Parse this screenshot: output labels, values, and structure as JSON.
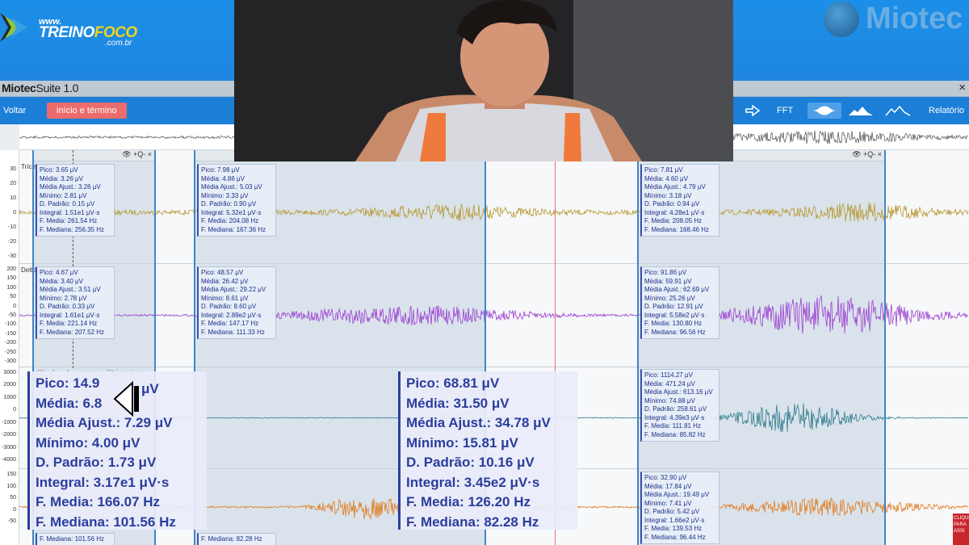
{
  "brand": {
    "www": "www.",
    "name_a": "TREINO",
    "name_b": "FOCO",
    "domain": ".com.br",
    "partner": "Miotec"
  },
  "app": {
    "title_a": "Miotec",
    "title_b": "Suite 1.0",
    "close": "×"
  },
  "toolbar": {
    "voltar": "Voltar",
    "inicio_termino": "início e término",
    "fft": "FFT",
    "relatorio": "Relatório"
  },
  "colors": {
    "ch1": "#b8972f",
    "ch2": "#9b3fd1",
    "ch3": "#2f7b8e",
    "ch4": "#e07a1e",
    "accent": "#1b7fd7",
    "stat_text": "#1d2f8a"
  },
  "axis_ticks": {
    "ch1": [
      "30",
      "20",
      "10",
      "0",
      "-10",
      "-20",
      "-30"
    ],
    "ch2": [
      "200",
      "150",
      "100",
      "50",
      "0",
      "-50",
      "-100",
      "-150",
      "-200",
      "-250",
      "-300"
    ],
    "ch3": [
      "3000",
      "2000",
      "1000",
      "0",
      "-1000",
      "-2000",
      "-3000",
      "-4000"
    ],
    "ch4": [
      "150",
      "100",
      "50",
      "0",
      "-50"
    ]
  },
  "channels": {
    "ch1_label": "Tríceps Direito",
    "ch2_label": "Deltoide Direito",
    "ch3_label": "Cab. Longa Direito"
  },
  "window_controls": "👁  +Q-  ×",
  "stats": {
    "ch1_w1": [
      "Pico: 3.65 μV",
      "Média: 3.26 μV",
      "Média Ajust.: 3.26 μV",
      "Mínimo: 2.81 μV",
      "D. Padrão: 0.15 μV",
      "Integral: 1.51e1 μV·s",
      "F. Media: 261.54 Hz",
      "F. Mediana: 256.35 Hz"
    ],
    "ch1_w2": [
      "Pico: 7.98 μV",
      "Média: 4.86 μV",
      "Média Ajust.: 5.03 μV",
      "Mínimo: 3.33 μV",
      "D. Padrão: 0.90 μV",
      "Integral: 5.32e1 μV·s",
      "F. Media: 204.08 Hz",
      "F. Mediana: 167.36 Hz"
    ],
    "ch1_w3": [
      "Pico: 7.81 μV",
      "Média: 4.60 μV",
      "Média Ajust.: 4.79 μV",
      "Mínimo: 3.18 μV",
      "D. Padrão: 0.94 μV",
      "Integral: 4.28e1 μV·s",
      "F. Media: 208.05 Hz",
      "F. Mediana: 168.46 Hz"
    ],
    "ch2_w1": [
      "Pico: 4.67 μV",
      "Média: 3.40 μV",
      "Média Ajust.: 3.51 μV",
      "Mínimo: 2.78 μV",
      "D. Padrão: 0.33 μV",
      "Integral: 1.61e1 μV·s",
      "F. Media: 221.14 Hz",
      "F. Mediana: 207.52 Hz"
    ],
    "ch2_w2": [
      "Pico: 48.57 μV",
      "Média: 26.42 μV",
      "Média Ajust.: 29.22 μV",
      "Mínimo: 8.61 μV",
      "D. Padrão: 8.60 μV",
      "Integral: 2.89e2 μV·s",
      "F. Media: 147.17 Hz",
      "F. Mediana: 111.33 Hz"
    ],
    "ch2_w3": [
      "Pico: 91.86 μV",
      "Média: 59.91 μV",
      "Média Ajust.: 62.69 μV",
      "Mínimo: 25.26 μV",
      "D. Padrão: 12.91 μV",
      "Integral: 5.58e2 μV·s",
      "F. Media: 130.80 Hz",
      "F. Mediana: 96.56 Hz"
    ],
    "ch3_w3": [
      "Pico: 1114.27 μV",
      "Média: 471.24 μV",
      "Média Ajust.: 613.16 μV",
      "Mínimo: 74.88 μV",
      "D. Padrão: 258.61 μV",
      "Integral: 4.39e3 μV·s",
      "F. Media: 111.81 Hz",
      "F. Mediana: 85.82 Hz"
    ],
    "ch4_w3": [
      "Pico: 32.90 μV",
      "Média: 17.84 μV",
      "Média Ajust.: 19.49 μV",
      "Mínimo: 7.41 μV",
      "D. Padrão: 5.42 μV",
      "Integral: 1.66e2 μV·s",
      "F. Media: 139.53 Hz",
      "F. Mediana: 96.44 Hz"
    ],
    "ch4_w1_tail": "F. Mediana: 101.56 Hz",
    "ch4_w2_tail": "F. Mediana: 82.28 Hz"
  },
  "zoom": {
    "left": [
      "Pico: 14.9",
      "Média: 6.8",
      "Média Ajust.: 7.29 μV",
      "Mínimo: 4.00 μV",
      "D. Padrão: 1.73 μV",
      "Integral: 3.17e1 μV·s",
      "F. Media: 166.07 Hz",
      "F. Mediana: 101.56 Hz"
    ],
    "left_partial_unit": "μV",
    "right": [
      "Pico: 68.81 μV",
      "Média: 31.50 μV",
      "Média Ajust.: 34.78 μV",
      "Mínimo: 15.81 μV",
      "D. Padrão: 10.16 μV",
      "Integral: 3.45e2 μV·s",
      "F. Media: 126.20 Hz",
      "F. Mediana: 82.28 Hz"
    ]
  },
  "side_badge": "CLIQUE PARA ASSI"
}
